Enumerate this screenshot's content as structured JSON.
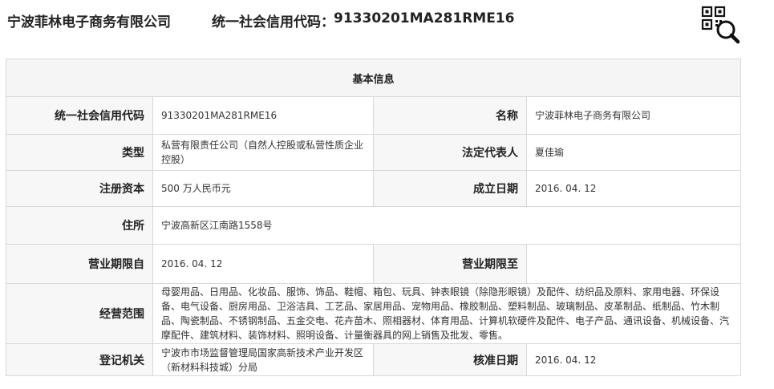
{
  "header": {
    "company_name": "宁波菲林电子商务有限公司",
    "credit_code_label": "统一社会信用代码：",
    "credit_code": "91330201MA281RME16",
    "qr_search_icon": "qr-code-search-icon"
  },
  "section": {
    "title": "基本信息"
  },
  "rows": {
    "credit": {
      "label": "统一社会信用代码",
      "value": "91330201MA281RME16",
      "label2": "名称",
      "value2": "宁波菲林电子商务有限公司"
    },
    "type": {
      "label": "类型",
      "value": "私营有限责任公司（自然人控股或私营性质企业控股）",
      "label2": "法定代表人",
      "value2": "夏佳瑜"
    },
    "capital": {
      "label": "注册资本",
      "value": "500 万人民币元",
      "label2": "成立日期",
      "value2": "2016. 04. 12"
    },
    "address": {
      "label": "住所",
      "value": "宁波高新区江南路1558号"
    },
    "term": {
      "label": "营业期限自",
      "value": "2016. 04. 12",
      "label2": "营业期限至",
      "value2": ""
    },
    "scope": {
      "label": "经营范围",
      "value": "母婴用品、日用品、化妆品、服饰、饰品、鞋帽、箱包、玩具、钟表眼镜（除隐形眼镜）及配件、纺织品及原料、家用电器、环保设备、电气设备、厨房用品、卫浴洁具、工艺品、家居用品、宠物用品、橡胶制品、塑料制品、玻璃制品、皮革制品、纸制品、竹木制品、陶瓷制品、不锈钢制品、五金交电、花卉苗木、照相器材、体育用品、计算机软硬件及配件、电子产品、通讯设备、机械设备、汽摩配件、建筑材料、装饰材料、照明设备、计量衡器具的网上销售及批发、零售。"
    },
    "registry": {
      "label": "登记机关",
      "value": "宁波市市场监督管理局国家高新技术产业开发区（新材料科技城）分局",
      "label2": "核准日期",
      "value2": "2016. 04. 12"
    }
  }
}
